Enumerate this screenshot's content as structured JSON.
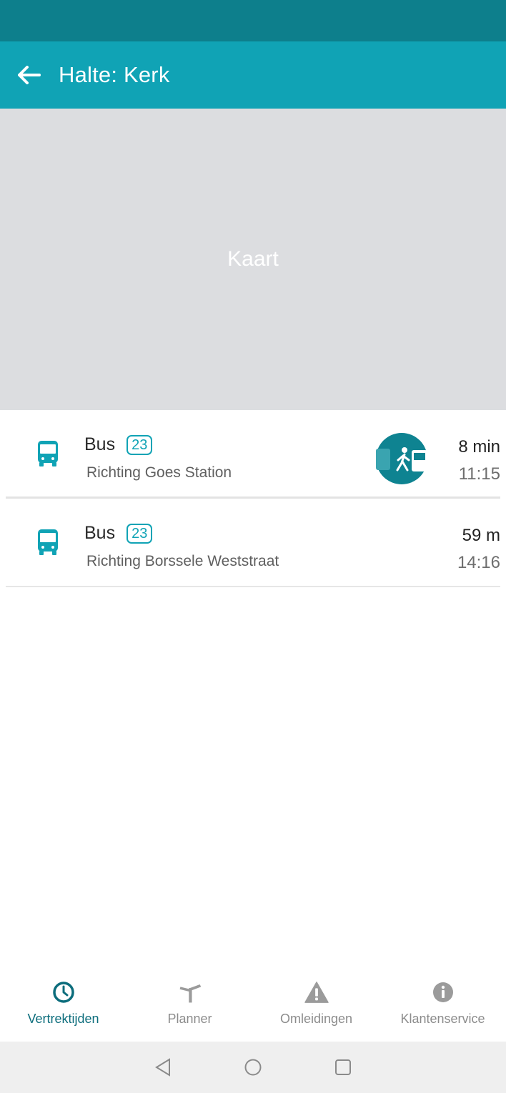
{
  "header": {
    "title": "Halte: Kerk",
    "back_icon": "arrow-left-icon"
  },
  "map": {
    "placeholder": "Kaart"
  },
  "departures": [
    {
      "mode": "Bus",
      "line": "23",
      "direction": "Richting Goes Station",
      "relative_time": "8 min",
      "time": "11:15",
      "walk_indicator": true,
      "icon": "bus-icon"
    },
    {
      "mode": "Bus",
      "line": "23",
      "direction": "Richting Borssele Weststraat",
      "relative_time": "59 m",
      "time": "14:16",
      "walk_indicator": false,
      "icon": "bus-icon"
    }
  ],
  "bottom_nav": {
    "items": [
      {
        "label": "Vertrektijden",
        "icon": "clock-icon",
        "active": true
      },
      {
        "label": "Planner",
        "icon": "signpost-icon",
        "active": false
      },
      {
        "label": "Omleidingen",
        "icon": "warning-icon",
        "active": false
      },
      {
        "label": "Klantenservice",
        "icon": "info-icon",
        "active": false
      }
    ]
  },
  "colors": {
    "status_bar": "#0d7f8c",
    "app_bar": "#10a3b5",
    "accent": "#10a3b5",
    "active_nav": "#0c6d7c",
    "map_bg": "#dcdde0"
  }
}
